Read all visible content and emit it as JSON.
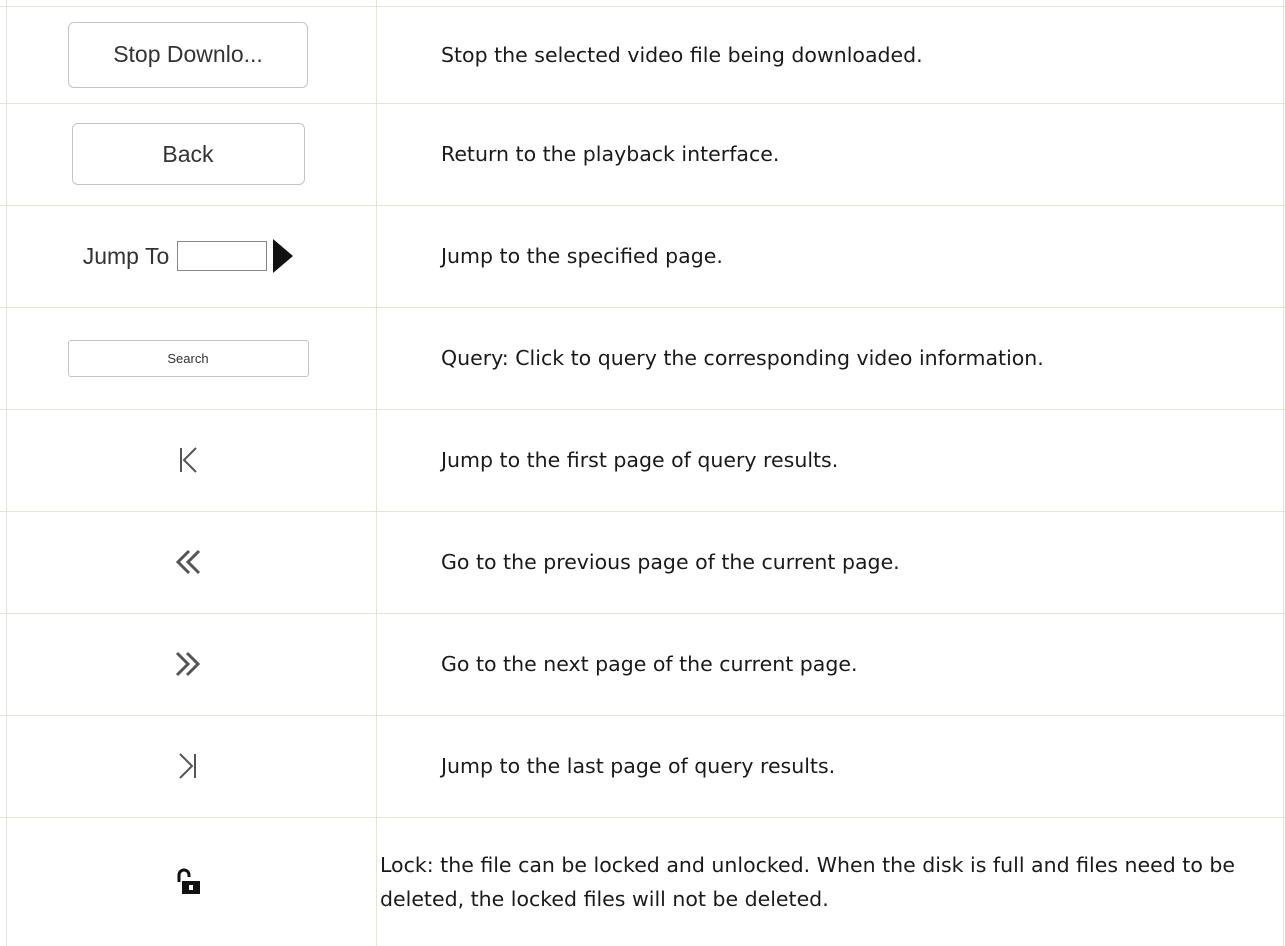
{
  "rows": [
    {
      "control": {
        "type": "button",
        "label": "Stop Downlo..."
      },
      "description": "Stop the selected video file being downloaded."
    },
    {
      "control": {
        "type": "button",
        "label": "Back"
      },
      "description": "Return to the playback interface."
    },
    {
      "control": {
        "type": "jump-to",
        "label": "Jump To",
        "value": "",
        "icon": "play-triangle-icon"
      },
      "description": "Jump to the specified page."
    },
    {
      "control": {
        "type": "button",
        "label": "Search"
      },
      "description": "Query: Click to query the corresponding video information."
    },
    {
      "control": {
        "type": "icon",
        "icon": "first-page-icon",
        "glyph": "K"
      },
      "description": "Jump to the first page of query results."
    },
    {
      "control": {
        "type": "icon",
        "icon": "previous-page-icon",
        "glyph": "«"
      },
      "description": "Go to the previous page of the current page."
    },
    {
      "control": {
        "type": "icon",
        "icon": "next-page-icon",
        "glyph": "»"
      },
      "description": "Go to the next page of the current page."
    },
    {
      "control": {
        "type": "icon",
        "icon": "last-page-icon",
        "glyph": ">|"
      },
      "description": "Jump to the last page of query results."
    },
    {
      "control": {
        "type": "icon",
        "icon": "unlock-icon"
      },
      "description": "Lock: the file can be locked and unlocked. When the disk is full and files need to be deleted, the locked files will not be deleted."
    }
  ],
  "colors": {
    "grid": "#e7e4d3",
    "button_border": "#c4c4c4",
    "text": "#1a1a1a"
  }
}
